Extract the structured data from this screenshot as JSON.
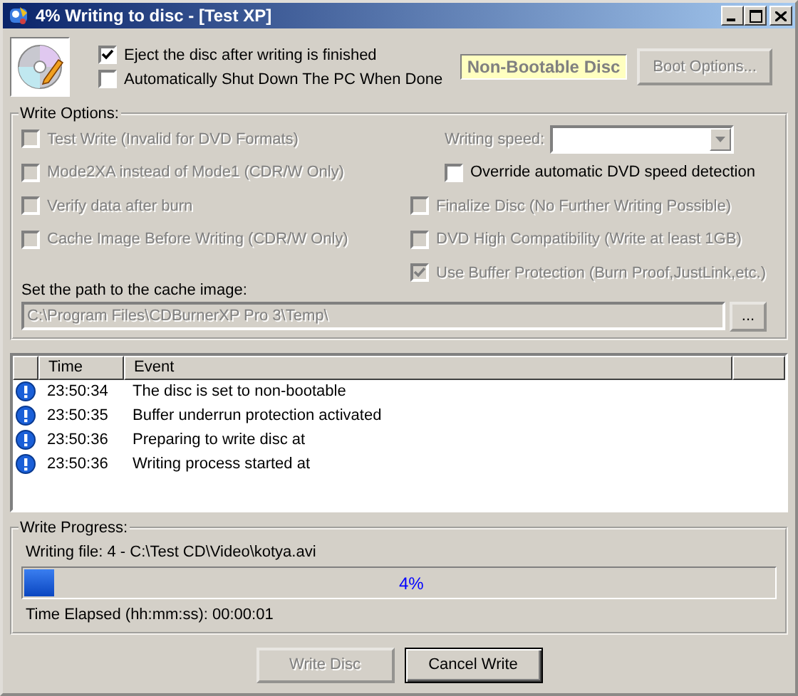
{
  "window": {
    "title": "4% Writing to disc - [Test XP]"
  },
  "after_write": {
    "options": [
      {
        "label": "Eject the disc after writing is finished",
        "checked": true
      },
      {
        "label": "Automatically Shut Down The PC When Done",
        "checked": false
      }
    ],
    "boot_status": "Non-Bootable Disc",
    "boot_button": {
      "label": "Boot Options...",
      "disabled": true
    }
  },
  "write_options": {
    "title": "Write Options:",
    "left": [
      {
        "label": "Test Write (Invalid for DVD Formats)",
        "checked": false,
        "disabled": true
      },
      {
        "label": "Mode2XA instead of Mode1 (CDR/W Only)",
        "checked": false,
        "disabled": true
      },
      {
        "label": "Verify data after burn",
        "checked": false,
        "disabled": true
      },
      {
        "label": "Cache Image Before Writing (CDR/W Only)",
        "checked": false,
        "disabled": true
      }
    ],
    "speed": {
      "label": "Writing speed:",
      "disabled": true
    },
    "override": {
      "label": "Override automatic DVD speed detection",
      "checked": false,
      "disabled": false
    },
    "right": [
      {
        "label": "Finalize Disc (No Further Writing Possible)",
        "checked": false,
        "disabled": true
      },
      {
        "label": "DVD High Compatibility (Write at least 1GB)",
        "checked": false,
        "disabled": true
      },
      {
        "label": "Use Buffer Protection (Burn Proof,JustLink,etc.)",
        "checked": true,
        "disabled": true
      }
    ],
    "cache_path": {
      "label": "Set the path to the cache image:",
      "value": "C:\\Program Files\\CDBurnerXP Pro 3\\Temp\\",
      "disabled": true
    },
    "browse_button": {
      "label": "..."
    }
  },
  "log": {
    "columns": [
      "Time",
      "Event"
    ],
    "rows": [
      {
        "kind": "info",
        "time": "23:50:34",
        "event": "The disc is set to non-bootable"
      },
      {
        "kind": "info",
        "time": "23:50:35",
        "event": "Buffer underrun protection activated"
      },
      {
        "kind": "info",
        "time": "23:50:36",
        "event": "Preparing to write disc at"
      },
      {
        "kind": "info",
        "time": "23:50:36",
        "event": "Writing process started at"
      }
    ]
  },
  "progress": {
    "title": "Write Progress:",
    "file": "Writing file: 4 - C:\\Test CD\\Video\\kotya.avi",
    "level": 0.04,
    "reading": "4%",
    "elapsed": "Time Elapsed (hh:mm:ss): 00:00:01"
  },
  "buttons": [
    {
      "label": "Write Disc",
      "disabled": true
    },
    {
      "label": "Cancel Write",
      "disabled": false
    }
  ]
}
